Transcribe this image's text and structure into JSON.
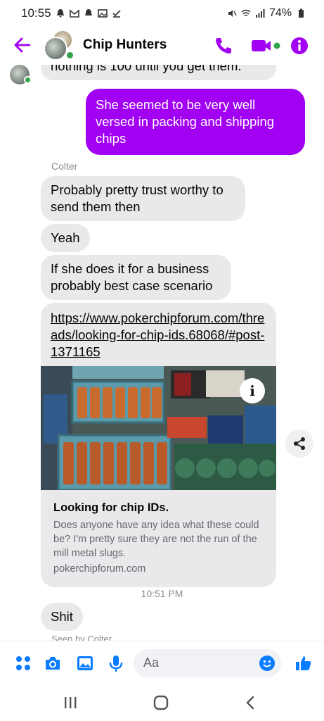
{
  "status_bar": {
    "time": "10:55",
    "battery": "74%"
  },
  "header": {
    "title": "Chip Hunters"
  },
  "colors": {
    "accent": "#a100f2",
    "incoming_bubble": "#e9e9eb",
    "online": "#31a24c",
    "composer_blue": "#0a7cff"
  },
  "messages": {
    "cut_off_text": "nothing is 100 until you get them.",
    "outgoing_1": "She seemed to be very well versed in packing and shipping chips",
    "sender_name": "Colter",
    "incoming_1": "Probably pretty trust worthy to send them then",
    "incoming_2": "Yeah",
    "incoming_3": "If she does it for a business probably best case scenario",
    "link_url": "https://www.pokerchipforum.com/threads/looking-for-chip-ids.68068/#post-1371165",
    "link_title": "Looking for chip IDs.",
    "link_description": "Does anyone have any idea what these could be? I'm pretty sure they are not the run of the mill metal slugs.",
    "link_domain": "pokerchipforum.com",
    "timestamp": "10:51 PM",
    "incoming_4": "Shit",
    "seen_status": "Seen by Colter"
  },
  "composer": {
    "placeholder": "Aa"
  },
  "icons": [
    "back-arrow-icon",
    "phone-icon",
    "video-icon",
    "info-icon",
    "apps-icon",
    "camera-icon",
    "gallery-icon",
    "mic-icon",
    "emoji-icon",
    "thumbs-up-icon",
    "share-icon",
    "recents-icon",
    "home-icon",
    "back-nav-icon"
  ]
}
